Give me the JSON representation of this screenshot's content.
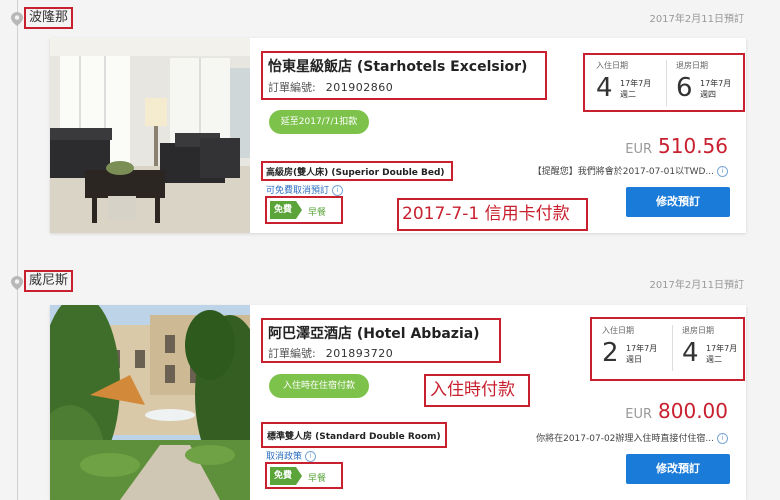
{
  "bookings": [
    {
      "city": "波隆那",
      "booked_date": "2017年2月11日預訂",
      "hotel_name": "怡東星級飯店 (Starhotels Excelsior)",
      "order_label": "訂單編號:",
      "order_number": "201902860",
      "payment_pill": "延至2017/7/1扣款",
      "room_type": "高級房(雙人床) (Superior Double Bed)",
      "cancel_text": "可免費取消預訂",
      "free_label": "免費",
      "meal_label": "早餐",
      "annotation": "2017-7-1 信用卡付款",
      "checkin": {
        "label": "入住日期",
        "day": "4",
        "month": "17年7月",
        "weekday": "週二"
      },
      "checkout": {
        "label": "退房日期",
        "day": "6",
        "month": "17年7月",
        "weekday": "週四"
      },
      "currency": "EUR",
      "amount": "510.56",
      "note": "【提醒您】我們將會於2017-07-01以TWD...",
      "button": "修改預訂"
    },
    {
      "city": "威尼斯",
      "booked_date": "2017年2月11日預訂",
      "hotel_name": "阿巴澤亞酒店 (Hotel Abbazia)",
      "order_label": "訂單編號:",
      "order_number": "201893720",
      "payment_pill": "入住時在住宿付款",
      "room_type": "標準雙人房 (Standard Double Room)",
      "cancel_text": "取消政策",
      "free_label": "免費",
      "meal_label": "早餐",
      "annotation": "入住時付款",
      "checkin": {
        "label": "入住日期",
        "day": "2",
        "month": "17年7月",
        "weekday": "週日"
      },
      "checkout": {
        "label": "退房日期",
        "day": "4",
        "month": "17年7月",
        "weekday": "週二"
      },
      "currency": "EUR",
      "amount": "800.00",
      "note": "你將在2017-07-02辦理入住時直接付住宿...",
      "button": "修改預訂"
    }
  ],
  "colors": {
    "accent_red": "#c8202f",
    "button_blue": "#1a7bd8",
    "green": "#7dc24b"
  },
  "icons": {
    "location": "map-pin-icon",
    "info": "info-icon"
  }
}
